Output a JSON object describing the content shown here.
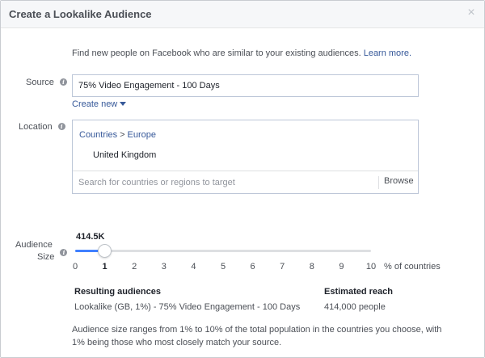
{
  "dialog": {
    "title": "Create a Lookalike Audience",
    "close_symbol": "×",
    "intro_text": "Find new people on Facebook who are similar to your existing audiences.",
    "learn_more": "Learn more."
  },
  "source": {
    "label": "Source",
    "value": "75% Video Engagement - 100 Days",
    "create_new": "Create new"
  },
  "location": {
    "label": "Location",
    "breadcrumb": [
      "Countries",
      "Europe"
    ],
    "breadcrumb_sep": ">",
    "selected": "United Kingdom",
    "search_placeholder": "Search for countries or regions to target",
    "browse": "Browse"
  },
  "audience_size": {
    "label_line1": "Audience",
    "label_line2": "Size",
    "value_label": "414.5K",
    "selected_percent": 1,
    "range": [
      0,
      10
    ],
    "ticks": [
      "0",
      "1",
      "2",
      "3",
      "4",
      "5",
      "6",
      "7",
      "8",
      "9",
      "10"
    ],
    "unit_label": "% of countries"
  },
  "results": {
    "resulting_header": "Resulting audiences",
    "resulting_value": "Lookalike (GB, 1%) - 75% Video Engagement - 100 Days",
    "reach_header": "Estimated reach",
    "reach_value": "414,000 people"
  },
  "footnote": "Audience size ranges from 1% to 10% of the total population in the countries you choose, with 1% being those who most closely match your source.",
  "icons": {
    "info": "info-icon",
    "close": "close-icon",
    "caret": "caret-down-icon"
  },
  "colors": {
    "link": "#365899",
    "slider_fill": "#4080ff"
  }
}
